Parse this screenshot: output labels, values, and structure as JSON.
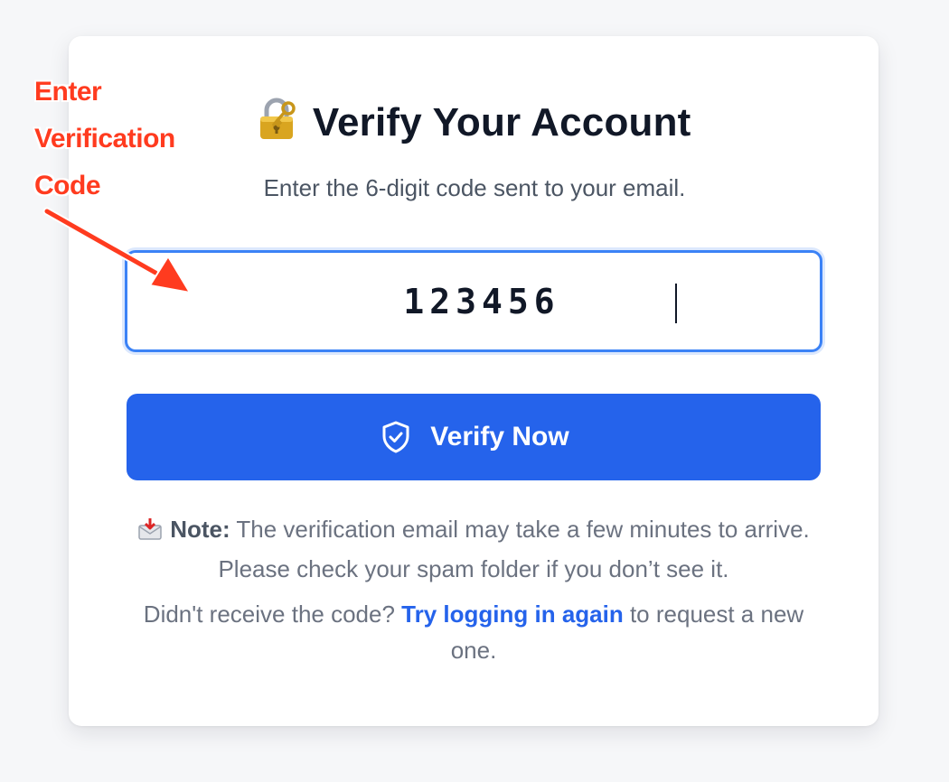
{
  "card": {
    "title": "Verify Your Account",
    "subtitle": "Enter the 6-digit code sent to your email.",
    "lock_icon": "locked-with-key-icon"
  },
  "code_input": {
    "value": "123456"
  },
  "verify_button": {
    "label": "Verify Now",
    "icon": "shield-check-icon"
  },
  "note": {
    "icon": "envelope-arrow-icon",
    "label": "Note:",
    "text": " The verification email may take a few minutes to arrive. Please check your spam folder if you don’t see it."
  },
  "resend": {
    "prefix": "Didn't receive the code? ",
    "link": "Try logging in again",
    "suffix": " to request a new one."
  },
  "annotation": {
    "line1": "Enter",
    "line2": "Verification",
    "line3": "Code",
    "color": "#ff3b1f"
  },
  "colors": {
    "accent": "#2563eb",
    "input_focus_border": "#3b82f6",
    "title": "#111827"
  }
}
